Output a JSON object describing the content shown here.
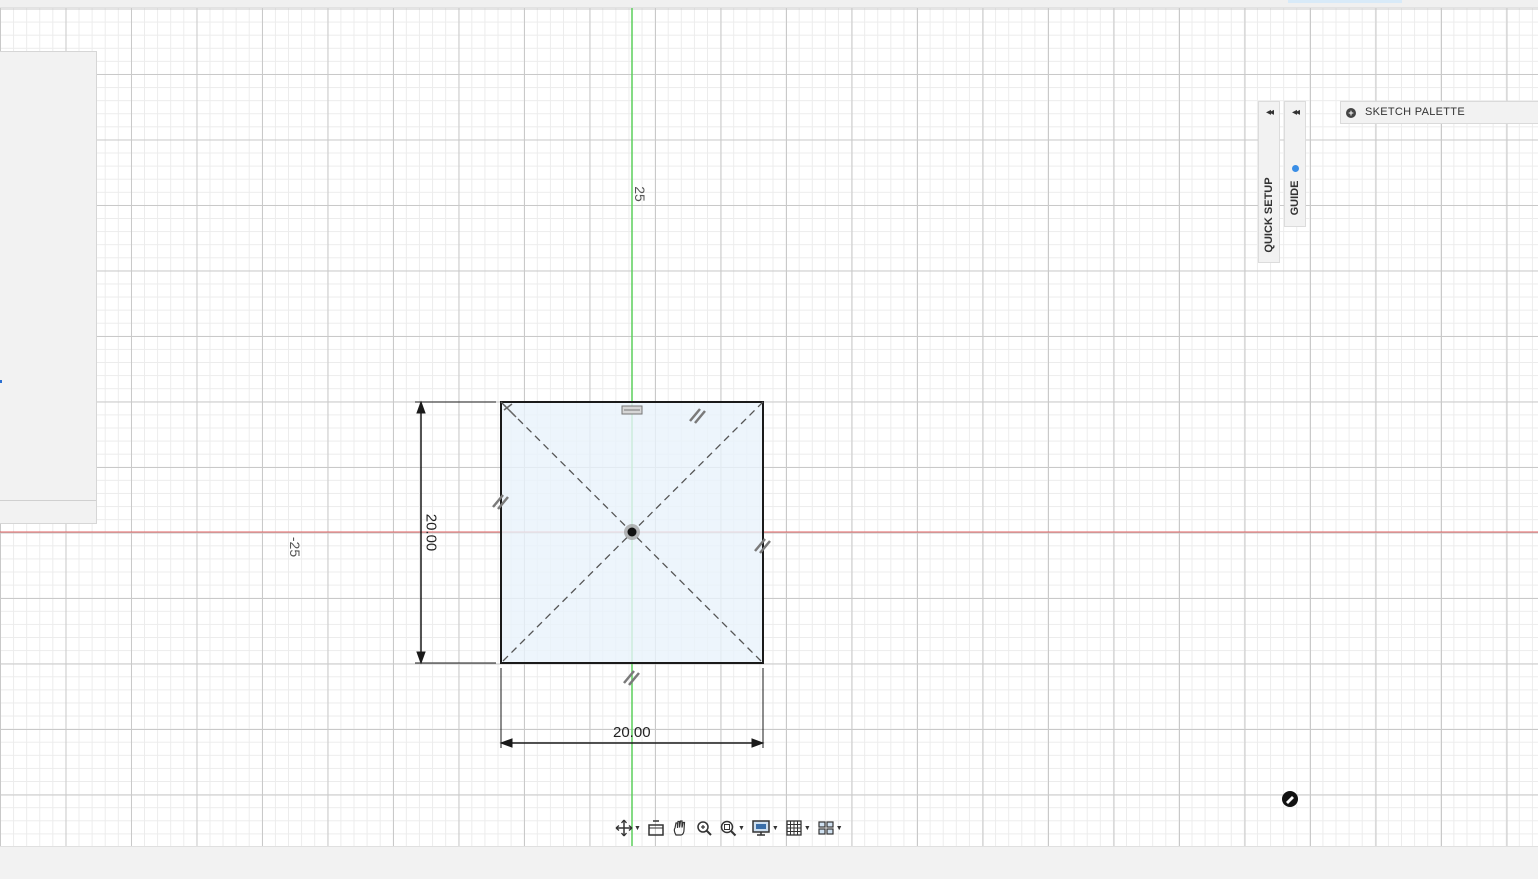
{
  "axis_labels": {
    "vertical_axis": "25",
    "horizontal_axis": "-25"
  },
  "dimensions": {
    "height": "20.00",
    "width": "20.00"
  },
  "side_tabs": {
    "quick_setup": {
      "collapse": "◂◂",
      "label": "QUICK SETUP"
    },
    "guide": {
      "collapse": "◂◂",
      "label": "GUIDE"
    }
  },
  "sketch_palette": {
    "icon": "+",
    "label": "SKETCH PALETTE"
  },
  "nav_toolbar": {
    "buttons": [
      {
        "icon": "orbit-icon",
        "has_menu": true
      },
      {
        "icon": "look-at-icon",
        "has_menu": false
      },
      {
        "icon": "pan-hand-icon",
        "has_menu": false
      },
      {
        "icon": "zoom-icon",
        "has_menu": false
      },
      {
        "icon": "fit-zoom-icon",
        "has_menu": true
      },
      {
        "icon": "display-settings-icon",
        "has_menu": true
      },
      {
        "icon": "grid-snaps-icon",
        "has_menu": true
      },
      {
        "icon": "viewports-icon",
        "has_menu": true
      }
    ]
  },
  "colors": {
    "x_axis": "#e06060",
    "y_axis": "#5ccf5c",
    "profile_fill": "#e8f2fb",
    "sketch_line": "#1a1a1a"
  }
}
